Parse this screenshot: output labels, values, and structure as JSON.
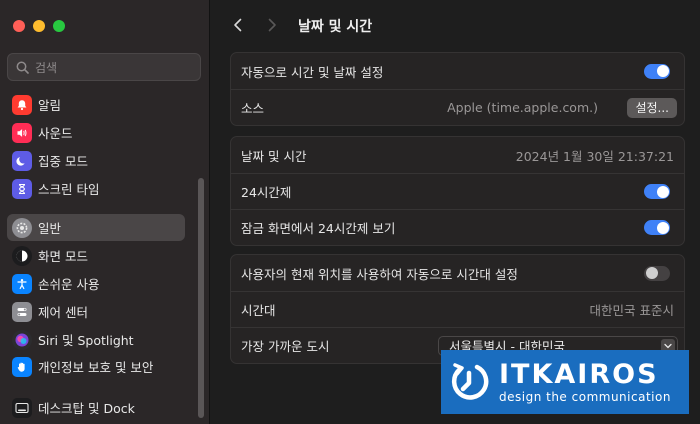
{
  "window": {
    "traffic_lights": [
      "close",
      "minimize",
      "zoom"
    ]
  },
  "sidebar": {
    "search_placeholder": "검색",
    "items": [
      {
        "label": "알림",
        "icon": "bell-icon",
        "color": "#ff3b30"
      },
      {
        "label": "사운드",
        "icon": "speaker-icon",
        "color": "#ff2d55"
      },
      {
        "label": "집중 모드",
        "icon": "moon-icon",
        "color": "#5e5ce6"
      },
      {
        "label": "스크린 타임",
        "icon": "hourglass-icon",
        "color": "#5e5ce6"
      },
      {
        "label": "일반",
        "icon": "gear-icon",
        "color": "#8e8e93",
        "selected": true
      },
      {
        "label": "화면 모드",
        "icon": "appearance-icon",
        "color": "#1c1c1e"
      },
      {
        "label": "손쉬운 사용",
        "icon": "accessibility-icon",
        "color": "#0a84ff"
      },
      {
        "label": "제어 센터",
        "icon": "control-center-icon",
        "color": "#8e8e93"
      },
      {
        "label": "Siri 및 Spotlight",
        "icon": "siri-icon",
        "color": "#2c2c2e"
      },
      {
        "label": "개인정보 보호 및 보안",
        "icon": "hand-icon",
        "color": "#0a84ff"
      },
      {
        "label": "데스크탑 및 Dock",
        "icon": "dock-icon",
        "color": "#1c1c1e"
      }
    ]
  },
  "toolbar": {
    "back_icon": "chevron-left-icon",
    "forward_icon": "chevron-right-icon",
    "title": "날짜 및 시간"
  },
  "groups": {
    "auto": {
      "auto_set_label": "자동으로 시간 및 날짜 설정",
      "auto_set_on": true,
      "source_label": "소스",
      "source_value": "Apple (time.apple.com.)",
      "source_button": "설정..."
    },
    "datetime": {
      "label": "날짜 및 시간",
      "value": "2024년 1월 30일 21:37:21",
      "h24_label": "24시간제",
      "h24_on": true,
      "lock_h24_label": "잠금 화면에서 24시간제 보기",
      "lock_h24_on": true
    },
    "timezone": {
      "auto_tz_label": "사용자의 현재 위치를 사용하여 자동으로 시간대 설정",
      "auto_tz_on": false,
      "tz_label": "시간대",
      "tz_value": "대한민국 표준시",
      "city_label": "가장 가까운 도시",
      "city_value": "서울특별시 - 대한민국"
    }
  },
  "watermark": {
    "name": "ITKAIROS",
    "tagline": "design the communication",
    "color": "#1a6dbf"
  },
  "colors": {
    "accent": "#3f81f7",
    "sidebar_bg": "#2b2728",
    "main_bg": "#1e1e1e"
  }
}
